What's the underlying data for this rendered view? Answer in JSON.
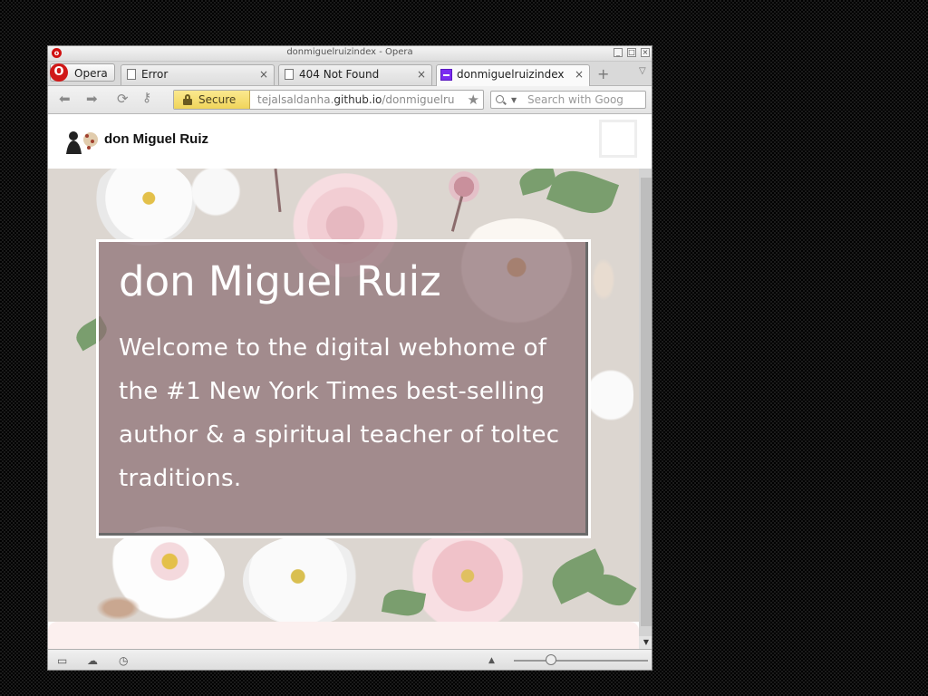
{
  "window": {
    "title": "donmiguelruizindex - Opera"
  },
  "opera_button": {
    "label": "Opera"
  },
  "tabs": [
    {
      "label": "Error",
      "close": "×"
    },
    {
      "label": "404 Not Found",
      "close": "×"
    },
    {
      "label": "donmiguelruizindex",
      "close": "×",
      "active": true
    }
  ],
  "newtab": "+",
  "address": {
    "secure_label": "Secure",
    "url_prefix": "tejalsaldanha.",
    "url_domain": "github.io",
    "url_path": "/donmiguelru",
    "search_placeholder": "Search with Goog"
  },
  "site": {
    "name": "don Miguel Ruiz",
    "hero_title": "don Miguel Ruiz",
    "hero_text": "Welcome to the digital webhome of the #1 New York Times best-selling author & a spiritual teacher of toltec traditions."
  },
  "colors": {
    "hero_bg": "#dcd6d0",
    "card_overlay": "#8c6e73",
    "secure_badge": "#f0d55a",
    "active_tab_icon": "#7b2cf0"
  },
  "icons": {
    "back": "arrow-left-icon",
    "forward": "arrow-right-icon",
    "reload": "reload-icon",
    "key": "key-icon",
    "lock": "lock-icon",
    "bookmark": "star-icon",
    "search": "search-icon",
    "menu": "hamburger-icon"
  }
}
